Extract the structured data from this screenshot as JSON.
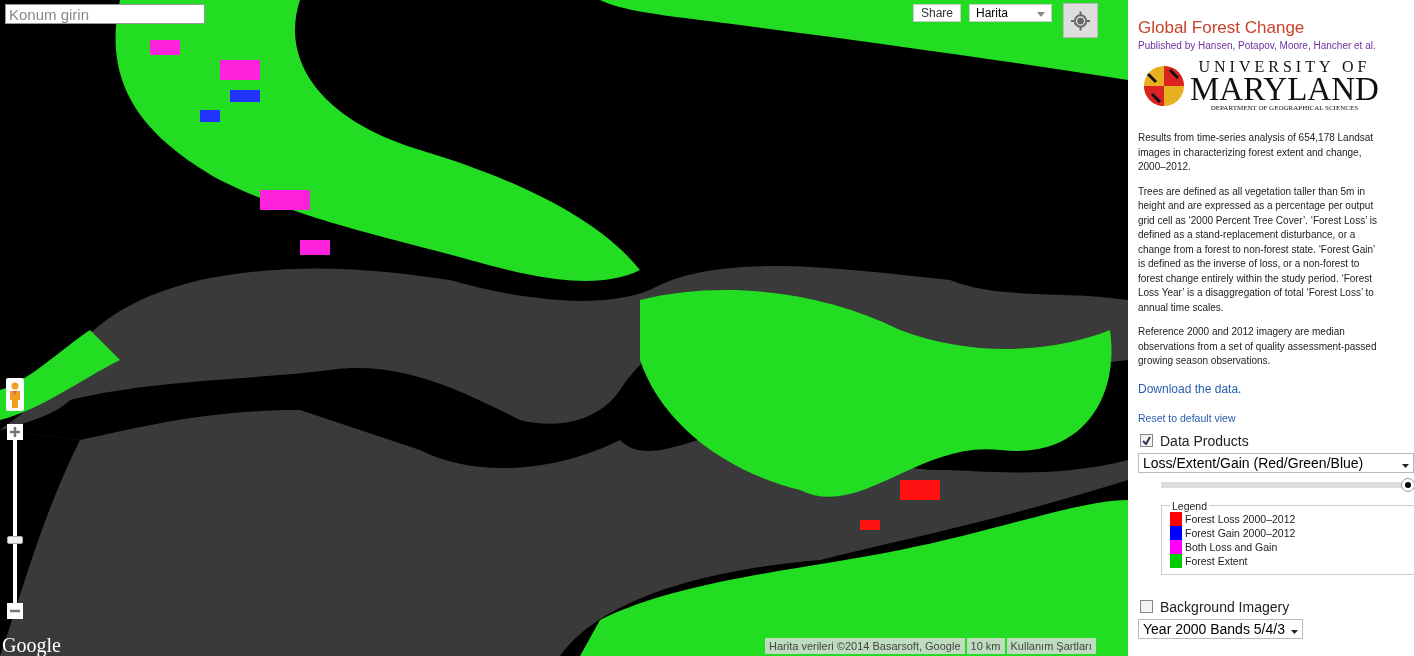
{
  "map": {
    "search": {
      "placeholder": "Konum girin"
    },
    "share_button": "Share",
    "map_type": {
      "value": "Harita"
    },
    "zoom": {
      "level": 0.39
    },
    "logo": "Google",
    "attribution": "Harita verileri ©2014 Basarsoft, Google",
    "scale": "10 km",
    "terms": "Kullanım Şartları"
  },
  "panel": {
    "title": "Global Forest Change",
    "byline": "Published by Hansen, Potapov, Moore, Hancher et al.",
    "university_logo": {
      "line_1": "UNIVERSITY OF",
      "line_2": "MARYLAND",
      "line_3": "DEPARTMENT OF GEOGRAPHICAL SCIENCES"
    },
    "paragraphs": [
      "Results from time-series analysis of 654,178 Landsat images in characterizing forest extent and change, 2000–2012.",
      "Trees are defined as all vegetation taller than 5m in height and are expressed as a percentage per output grid cell as ‘2000 Percent Tree Cover’. ‘Forest Loss’ is defined as a stand-replacement disturbance, or a change from a forest to non-forest state. ‘Forest Gain’ is defined as the inverse of loss, or a non-forest to forest change entirely within the study period. ‘Forest Loss Year’ is a disaggregation of total ‘Forest Loss’ to annual time scales.",
      "Reference 2000 and 2012 imagery are median observations from a set of quality assessment-passed growing season observations."
    ],
    "download_link": "Download the data.",
    "reset_link": "Reset to default view",
    "layers": [
      {
        "label": "Data Products",
        "checked": true,
        "dropdown": "Loss/Extent/Gain (Red/Green/Blue)",
        "opacity": {
          "level": 1
        },
        "legend": {
          "title": "Legend",
          "items": [
            {
              "label": "Forest Loss 2000–2012",
              "color": "#ff0000"
            },
            {
              "label": "Forest Gain 2000–2012",
              "color": "#0000ff"
            },
            {
              "label": "Both Loss and Gain",
              "color": "#ff00ff"
            },
            {
              "label": "Forest Extent",
              "color": "#00cc00"
            }
          ]
        }
      },
      {
        "label": "Background Imagery",
        "checked": false,
        "dropdown": "Year 2000 Bands 5/4/3"
      }
    ]
  }
}
